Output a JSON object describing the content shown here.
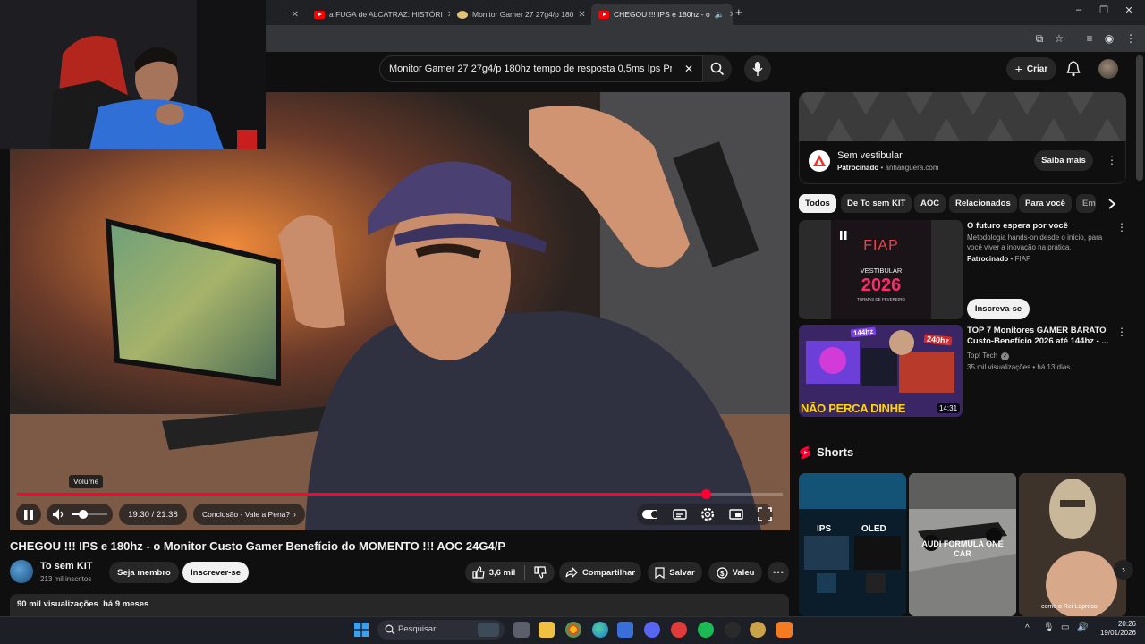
{
  "browser": {
    "tabs": [
      {
        "title": "a FUGA de ALCATRAZ: HISTÓRI"
      },
      {
        "title": "Monitor Gamer 27 27g4/p 180"
      },
      {
        "title": "CHEGOU !!! IPS e 180hz - o"
      }
    ],
    "new_tab": "+"
  },
  "youtube": {
    "search": {
      "query": "Monitor Gamer 27 27g4/p 180hz tempo de resposta 0,5ms Ips Pr"
    },
    "create_label": "Criar"
  },
  "player": {
    "volume_tooltip": "Volume",
    "time": "19:30 / 21:38",
    "chapter": "Conclusão - Vale a Pena?",
    "chapter_arrow": "›",
    "progress": 0.9
  },
  "video": {
    "title": "CHEGOU !!! IPS e 180hz - o Monitor Custo Gamer Benefício do MOMENTO !!! AOC 24G4/P",
    "channel": "To sem KIT",
    "subscribers": "213 mil inscritos",
    "member_label": "Seja membro",
    "subscribe_label": "Inscrever-se",
    "likes": "3,6 mil",
    "share_label": "Compartilhar",
    "save_label": "Salvar",
    "thanks_label": "Valeu",
    "views_date": "90 mil visualizações  há 9 meses"
  },
  "ad": {
    "title": "Sem vestibular",
    "sponsored": "Patrocinado",
    "domain": "anhanguera.com",
    "cta": "Saiba mais"
  },
  "chips": [
    "Todos",
    "De To sem KIT",
    "AOC",
    "Relacionados",
    "Para você",
    "Em"
  ],
  "recommendations": [
    {
      "title": "O futuro espera por você",
      "desc": "Metodologia hands-on desde o início, para você viver a inovação na prática.",
      "sponsored": "Patrocinado",
      "channel": "FIAP",
      "cta": "Inscreva-se",
      "thumb_brand": "FIAP",
      "thumb_line1": "VESTIBULAR",
      "thumb_year": "2026",
      "thumb_line2": "TURMAS DE FEVEREIRO"
    },
    {
      "title": "TOP 7 Monitores GAMER BARATO Custo-Benefício 2026 até 144hz - ...",
      "channel": "Top! Tech",
      "meta": "35 mil visualizações • há 13 dias",
      "duration": "14:31",
      "thumb_caption": "NÃO PERCA DINHE",
      "badge_a": "144hz",
      "badge_b": "240hz"
    }
  ],
  "shorts": {
    "heading": "Shorts",
    "items": [
      {
        "label_a": "IPS",
        "label_b": "OLED"
      },
      {
        "label": "AUDI FORMULA ONE CAR"
      },
      {
        "label": "como o Rei Leproso"
      }
    ]
  },
  "taskbar": {
    "search_placeholder": "Pesquisar",
    "time": "20:26",
    "date": "19/01/2026"
  }
}
